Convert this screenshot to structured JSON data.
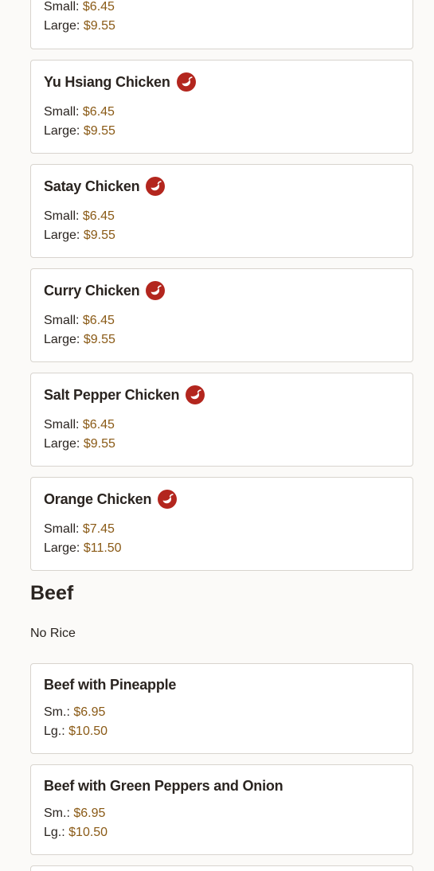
{
  "partial_top": {
    "small_label": "Small:",
    "small_price": "$6.45",
    "large_label": "Large:",
    "large_price": "$9.55"
  },
  "chicken_items": [
    {
      "name": "Yu Hsiang Chicken",
      "spicy_icon": "chili-pepper",
      "small_label": "Small:",
      "small_price": "$6.45",
      "large_label": "Large:",
      "large_price": "$9.55"
    },
    {
      "name": "Satay Chicken",
      "spicy_icon": "chili-pepper",
      "small_label": "Small:",
      "small_price": "$6.45",
      "large_label": "Large:",
      "large_price": "$9.55"
    },
    {
      "name": "Curry Chicken",
      "spicy_icon": "chili-pepper",
      "small_label": "Small:",
      "small_price": "$6.45",
      "large_label": "Large:",
      "large_price": "$9.55"
    },
    {
      "name": "Salt Pepper Chicken",
      "spicy_icon": "chili-pepper",
      "small_label": "Small:",
      "small_price": "$6.45",
      "large_label": "Large:",
      "large_price": "$9.55"
    },
    {
      "name": "Orange Chicken",
      "spicy_icon": "chili-pepper",
      "small_label": "Small:",
      "small_price": "$7.45",
      "large_label": "Large:",
      "large_price": "$11.50"
    }
  ],
  "beef_section": {
    "title": "Beef",
    "note": "No Rice",
    "items": [
      {
        "name": "Beef with Pineapple",
        "small_label": "Sm.:",
        "small_price": "$6.95",
        "large_label": "Lg.:",
        "large_price": "$10.50"
      },
      {
        "name": "Beef with Green Peppers and Onion",
        "small_label": "Sm.:",
        "small_price": "$6.95",
        "large_label": "Lg.:",
        "large_price": "$10.50"
      }
    ]
  },
  "colors": {
    "price": "#8a5a16",
    "spicy_icon": "#b3261e",
    "card_border": "#d8d4ce",
    "background": "#fbfaf8"
  }
}
